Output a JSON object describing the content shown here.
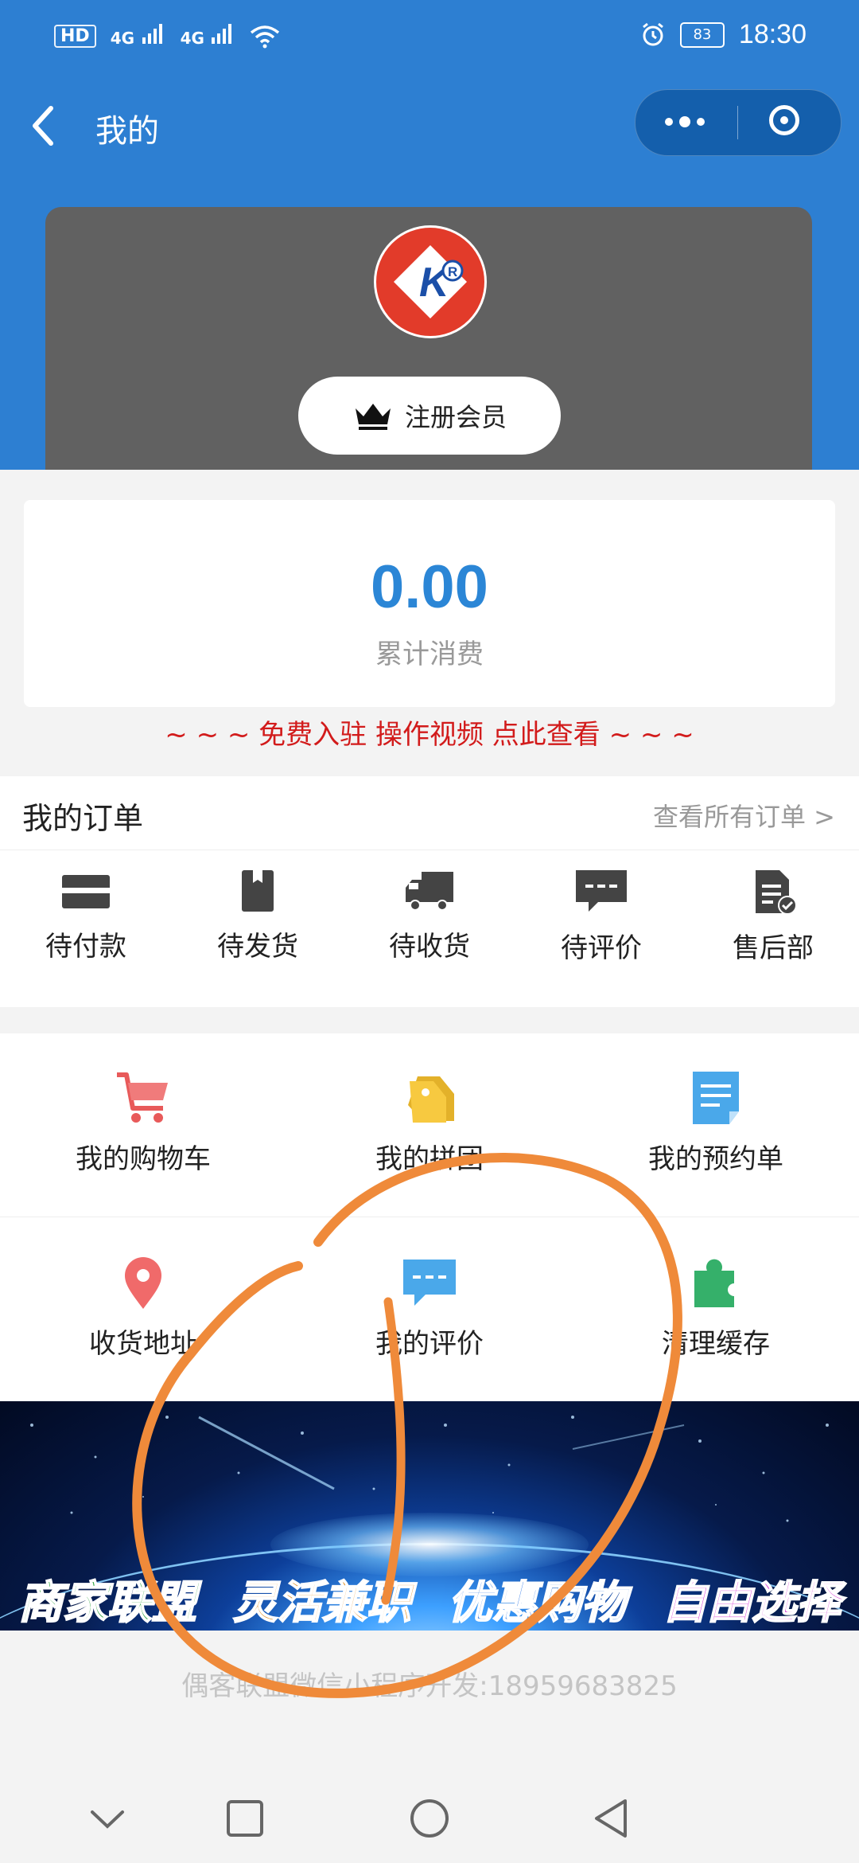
{
  "status_bar": {
    "hd_label": "HD",
    "sim1_label": "4G",
    "sim2_label": "4G",
    "battery_level": "83",
    "time": "18:30"
  },
  "nav": {
    "back_icon": "chevron-left-icon",
    "title": "我的",
    "more_icon": "more-dots-icon",
    "close_icon": "target-ring-icon"
  },
  "profile": {
    "logo_letter": "K",
    "register_label": "注册会员",
    "register_icon": "crown-icon"
  },
  "consumption": {
    "amount": "0.00",
    "label": "累计消费"
  },
  "promo_text": "~ ~ ~ 免费入驻 操作视频 点此查看 ~ ~ ~",
  "orders": {
    "title": "我的订单",
    "view_all": "查看所有订单 >",
    "items": [
      {
        "label": "待付款",
        "icon": "card-icon"
      },
      {
        "label": "待发货",
        "icon": "package-icon"
      },
      {
        "label": "待收货",
        "icon": "truck-icon"
      },
      {
        "label": "待评价",
        "icon": "comment-icon"
      },
      {
        "label": "售后部",
        "icon": "document-check-icon"
      }
    ]
  },
  "features": [
    {
      "label": "我的购物车",
      "icon": "cart-icon"
    },
    {
      "label": "我的拼团",
      "icon": "tags-icon"
    },
    {
      "label": "我的预约单",
      "icon": "note-icon"
    },
    {
      "label": "收货地址",
      "icon": "location-pin-icon"
    },
    {
      "label": "我的评价",
      "icon": "chat-bubble-icon"
    },
    {
      "label": "清理缓存",
      "icon": "puzzle-icon"
    }
  ],
  "banner": {
    "taglines": [
      "商家联盟",
      "灵活兼职",
      "优惠购物",
      "自由选择"
    ]
  },
  "footer_text": "偶客联盟微信小程序开发:18959683825",
  "colors": {
    "header_blue": "#2d7fd2",
    "amount_blue": "#2b86d6",
    "promo_red": "#d21b1b",
    "annotation_orange": "#ef8a3a"
  }
}
